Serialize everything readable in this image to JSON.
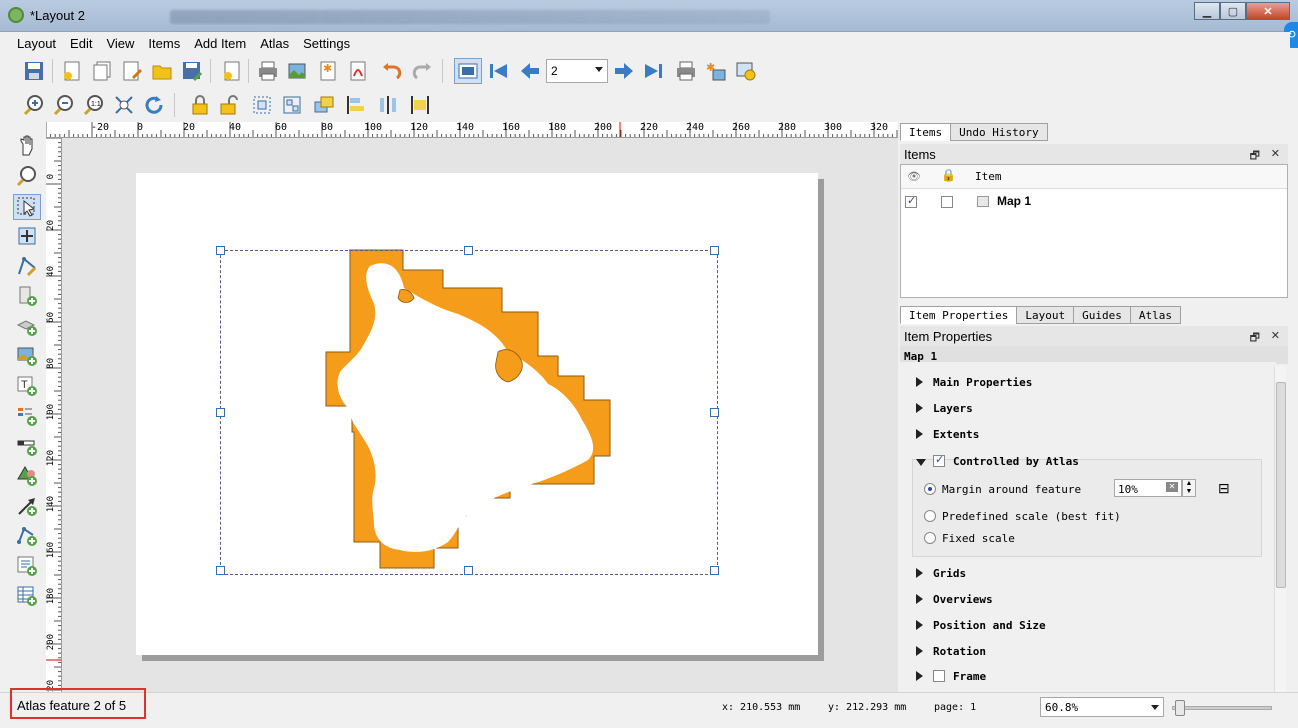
{
  "window": {
    "title": "*Layout 2"
  },
  "menu": [
    "Layout",
    "Edit",
    "View",
    "Items",
    "Add Item",
    "Atlas",
    "Settings"
  ],
  "atlas_toolbar": {
    "page_value": "2"
  },
  "ruler_h_ticks": [
    "-20",
    "0",
    "20",
    "40",
    "60",
    "80",
    "100",
    "120",
    "140",
    "160",
    "180",
    "200",
    "220",
    "240",
    "260",
    "280",
    "300",
    "320"
  ],
  "ruler_v_ticks": [
    "0",
    "20",
    "40",
    "60",
    "80",
    "100",
    "120",
    "140",
    "160",
    "180",
    "200",
    "220"
  ],
  "items_panel": {
    "tabs": [
      "Items",
      "Undo History"
    ],
    "header": "Items",
    "column_item": "Item",
    "rows": [
      {
        "name": "Map 1",
        "visible": true,
        "locked": false
      }
    ]
  },
  "props_panel": {
    "tabs": [
      "Item Properties",
      "Layout",
      "Guides",
      "Atlas"
    ],
    "header": "Item Properties",
    "item_name": "Map 1",
    "sections_top": [
      "Main Properties",
      "Layers",
      "Extents"
    ],
    "atlas_group": {
      "label": "Controlled by Atlas",
      "checked": true,
      "options": [
        "Margin around feature",
        "Predefined scale (best fit)",
        "Fixed scale"
      ],
      "margin_value": "10%"
    },
    "sections_bottom": [
      "Grids",
      "Overviews",
      "Position and Size",
      "Rotation",
      "Frame"
    ]
  },
  "status": {
    "message": "Atlas feature 2 of 5",
    "x": "x: 210.553 mm",
    "y": "y: 212.293 mm",
    "page": "page: 1",
    "zoom": "60.8%"
  },
  "colors": {
    "map_fill": "#f59d1a",
    "island_fill": "#ffffff",
    "selection": "#3a6ea5",
    "highlight_box": "#e03030"
  }
}
